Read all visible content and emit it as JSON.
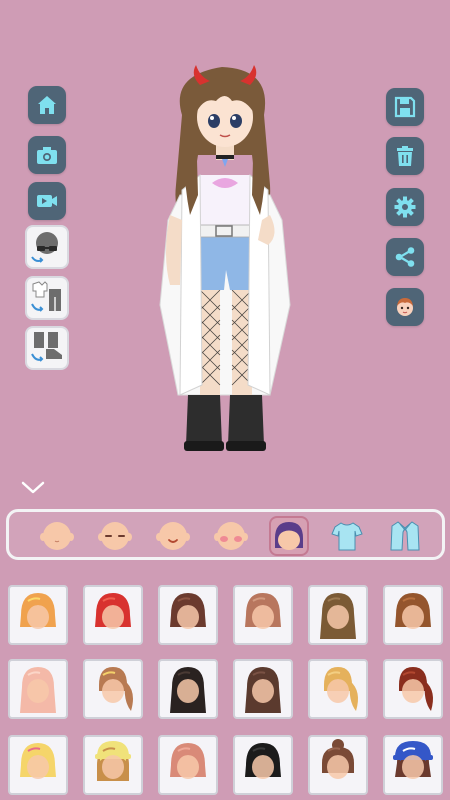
{
  "colors": {
    "background": "#cf9cb5",
    "button": "#4f6577",
    "tab_active": "#d6a0b3",
    "cell_bg": "#f5f4f8"
  },
  "left_toolbar": [
    {
      "name": "home",
      "icon": "home-icon"
    },
    {
      "name": "camera",
      "icon": "camera-icon"
    },
    {
      "name": "video",
      "icon": "video-camera-icon"
    }
  ],
  "preset_buttons": [
    {
      "name": "accessory-swap",
      "icon": "glasses-swap-icon"
    },
    {
      "name": "outfit-swap",
      "icon": "outfit-swap-icon"
    },
    {
      "name": "shoes-swap",
      "icon": "shoes-swap-icon"
    }
  ],
  "right_toolbar": [
    {
      "name": "save",
      "icon": "floppy-disk-icon"
    },
    {
      "name": "delete",
      "icon": "trash-icon"
    },
    {
      "name": "settings",
      "icon": "gear-icon"
    },
    {
      "name": "share",
      "icon": "share-icon"
    },
    {
      "name": "profile",
      "icon": "avatar-face-icon"
    }
  ],
  "category_tabs": [
    {
      "name": "face",
      "icon": "face-base-icon"
    },
    {
      "name": "eyes",
      "icon": "face-eyes-icon"
    },
    {
      "name": "mouth",
      "icon": "face-mouth-icon"
    },
    {
      "name": "blush",
      "icon": "face-blush-icon"
    },
    {
      "name": "hair",
      "icon": "hair-icon",
      "selected": true
    },
    {
      "name": "top",
      "icon": "shirt-icon"
    },
    {
      "name": "outerwear",
      "icon": "jacket-icon"
    }
  ],
  "hair_items": [
    {
      "color": "#f0a24e",
      "accent": "#fcd96a",
      "style": "wavy"
    },
    {
      "color": "#d8322f",
      "accent": "#f06050",
      "style": "curly"
    },
    {
      "color": "#6b3a2e",
      "accent": "#8d5443",
      "style": "bob"
    },
    {
      "color": "#b8765e",
      "accent": "#d29a80",
      "style": "buns"
    },
    {
      "color": "#7b5a35",
      "accent": "#9d7a52",
      "style": "braids"
    },
    {
      "color": "#94552d",
      "accent": "#b87140",
      "style": "bob-bangs"
    },
    {
      "color": "#f4b9a8",
      "accent": "#fbd6c8",
      "style": "long-wavy"
    },
    {
      "color": "#b87a52",
      "accent": "#f4d26b",
      "style": "pigtails"
    },
    {
      "color": "#2a2220",
      "accent": "#4a3a34",
      "style": "long-straight"
    },
    {
      "color": "#5b3a2e",
      "accent": "#7a5244",
      "style": "long-bangs"
    },
    {
      "color": "#e5b15c",
      "accent": "#f3cf83",
      "style": "ponytail"
    },
    {
      "color": "#8a2e1e",
      "accent": "#b24830",
      "style": "side-pony"
    },
    {
      "color": "#f5d56a",
      "accent": "#e86b8a",
      "style": "headband"
    },
    {
      "color": "#f0e27a",
      "accent": "#c88f4a",
      "style": "beanie"
    },
    {
      "color": "#d98a78",
      "accent": "#efa898",
      "style": "short"
    },
    {
      "color": "#1b1b1b",
      "accent": "#3a3a3a",
      "style": "hime"
    },
    {
      "color": "#7a4a36",
      "accent": "#9a6650",
      "style": "top-bun"
    },
    {
      "color": "#3457c8",
      "accent": "#ffffff",
      "style": "cap"
    }
  ]
}
